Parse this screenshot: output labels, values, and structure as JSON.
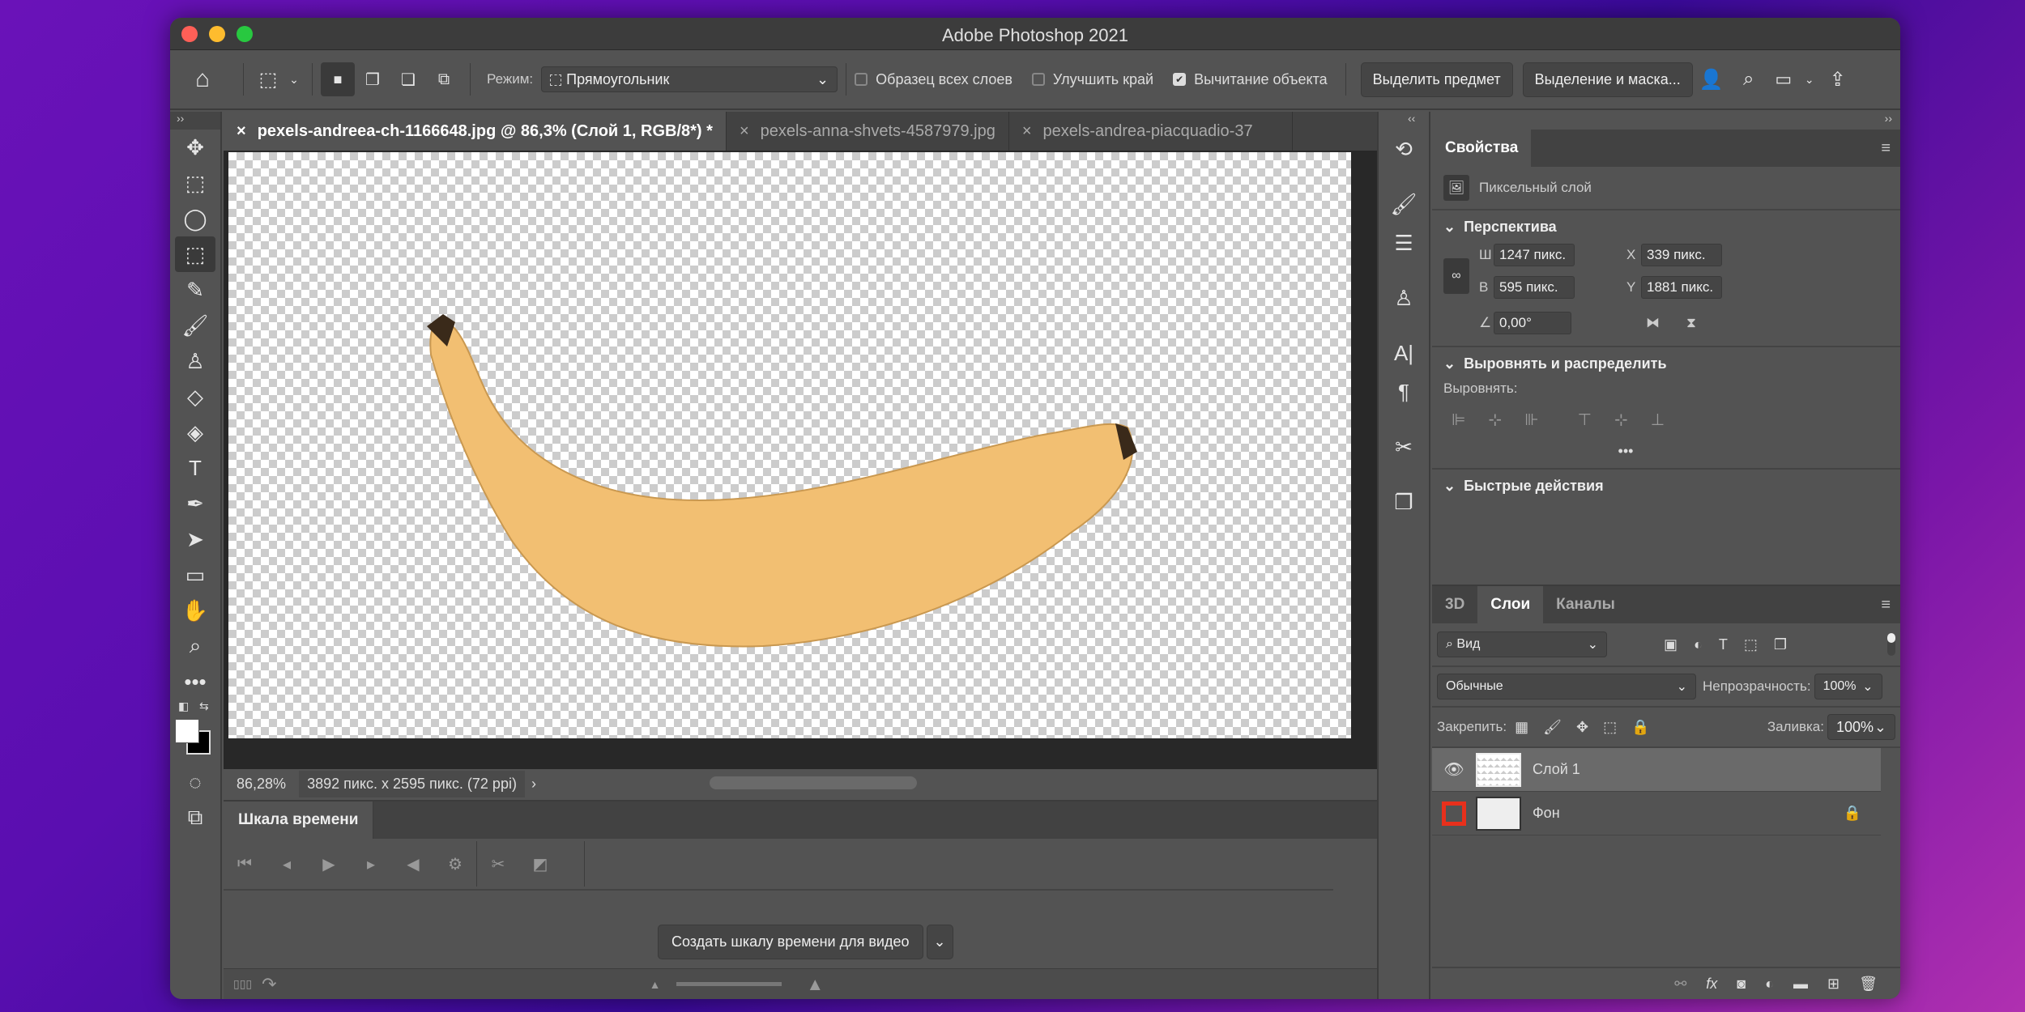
{
  "app": {
    "title": "Adobe Photoshop 2021"
  },
  "options": {
    "mode_label": "Режим:",
    "mode_value": "Прямоугольник",
    "sample_all_layers": {
      "label": "Образец всех слоев",
      "checked": false
    },
    "enhance_edge": {
      "label": "Улучшить край",
      "checked": false
    },
    "object_subtract": {
      "label": "Вычитание объекта",
      "checked": true
    },
    "select_subject": "Выделить предмет",
    "select_and_mask": "Выделение и маска..."
  },
  "tabs": [
    {
      "label": "pexels-andreea-ch-1166648.jpg @ 86,3% (Слой 1, RGB/8*) *",
      "active": true
    },
    {
      "label": "pexels-anna-shvets-4587979.jpg"
    },
    {
      "label": "pexels-andrea-piacquadio-37"
    }
  ],
  "status": {
    "zoom": "86,28%",
    "doc_info": "3892 пикс. x 2595 пикс. (72 ppi)"
  },
  "timeline": {
    "tab": "Шкала времени",
    "create_button": "Создать шкалу времени для видео"
  },
  "properties": {
    "tab": "Свойства",
    "layer_type": "Пиксельный слой",
    "transform_section": "Перспектива",
    "w_label": "Ш",
    "w": "1247 пикс.",
    "h_label": "В",
    "h": "595 пикс.",
    "x_label": "X",
    "x": "339 пикс.",
    "y_label": "Y",
    "y": "1881 пикс.",
    "angle": "0,00°",
    "align_section": "Выровнять и распределить",
    "align_label": "Выровнять:",
    "quick_section": "Быстрые действия"
  },
  "layers_panel": {
    "tabs": [
      "3D",
      "Слои",
      "Каналы"
    ],
    "active_tab": "Слои",
    "filter": "Вид",
    "blend_mode": "Обычные",
    "opacity_label": "Непрозрачность:",
    "opacity": "100%",
    "lock_label": "Закрепить:",
    "fill_label": "Заливка:",
    "fill": "100%",
    "layers": [
      {
        "name": "Слой 1",
        "visible": true,
        "selected": true
      },
      {
        "name": "Фон",
        "visible": false,
        "locked": true
      }
    ]
  },
  "colors": {
    "highlight_red": "#e8301c"
  }
}
